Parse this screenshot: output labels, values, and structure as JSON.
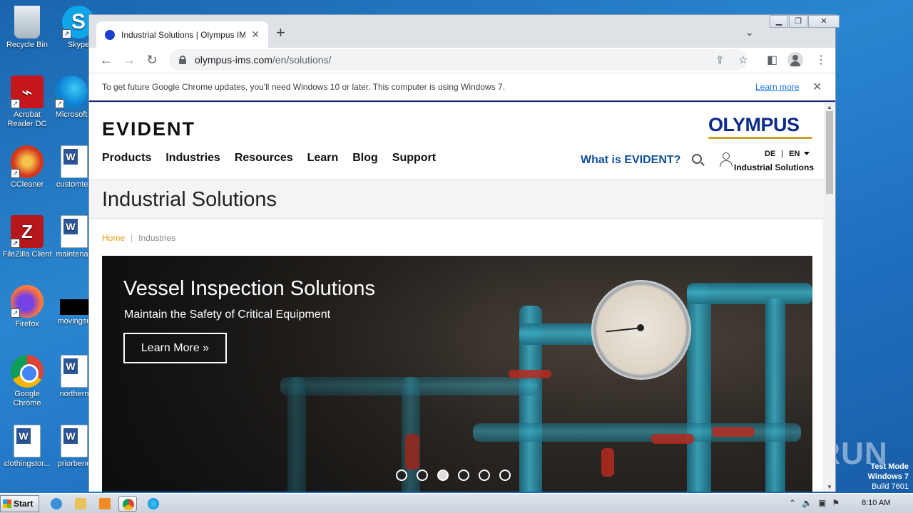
{
  "desktop": {
    "icons": [
      {
        "label": "Recycle Bin"
      },
      {
        "label": "Skype"
      },
      {
        "label": "Acrobat Reader DC"
      },
      {
        "label": "Microsoft"
      },
      {
        "label": "CCleaner"
      },
      {
        "label": "customtes"
      },
      {
        "label": "FileZilla Client"
      },
      {
        "label": "maintenan"
      },
      {
        "label": "Firefox"
      },
      {
        "label": "movingsu"
      },
      {
        "label": "Google Chrome"
      },
      {
        "label": "northern"
      },
      {
        "label": "clothingstor..."
      },
      {
        "label": "priorbene"
      }
    ],
    "watermark": "ANY RUN",
    "test_mode": {
      "line1": "Test Mode",
      "line2": "Windows 7",
      "line3": "Build 7601"
    }
  },
  "browser": {
    "tab": {
      "title": "Industrial Solutions | Olympus IMS",
      "close": "✕"
    },
    "new_tab": "+",
    "url": {
      "host": "olympus-ims.com",
      "path": "/en/solutions/"
    },
    "infobar": {
      "message": "To get future Google Chrome updates, you'll need Windows 10 or later. This computer is using Windows 7.",
      "link": "Learn more",
      "close": "✕"
    }
  },
  "page": {
    "logo_left": "EVIDENT",
    "logo_right": "OLYMPUS",
    "nav": [
      "Products",
      "Industries",
      "Resources",
      "Learn",
      "Blog",
      "Support"
    ],
    "what_is": "What is EVIDENT?",
    "lang": {
      "de": "DE",
      "sep": "|",
      "en": "EN"
    },
    "subsite": "Industrial Solutions",
    "title": "Industrial Solutions",
    "breadcrumb": {
      "home": "Home",
      "sep": "|",
      "current": "Industries"
    },
    "hero": {
      "title": "Vessel Inspection Solutions",
      "subtitle": "Maintain the Safety of Critical Equipment",
      "button": "Learn More »",
      "slides": 6,
      "active_slide": 3
    }
  },
  "taskbar": {
    "start": "Start",
    "clock": "8:10 AM"
  }
}
